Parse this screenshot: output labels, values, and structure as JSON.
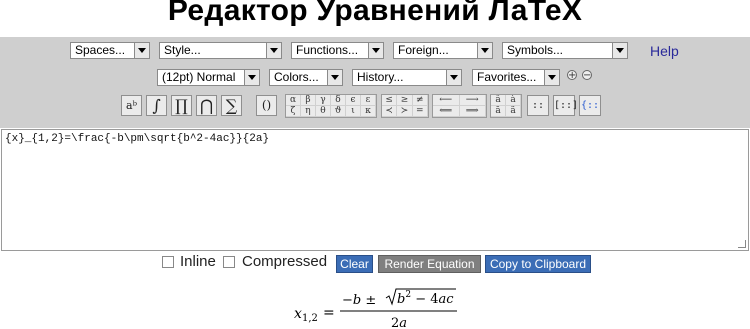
{
  "header": {
    "title": "Редактор Уравнений ЛаТеХ"
  },
  "toolbar": {
    "row1": [
      "Spaces...",
      "Style...",
      "Functions...",
      "Foreign...",
      "Symbols..."
    ],
    "help": "Help",
    "row2": [
      "(12pt) Normal",
      "Colors...",
      "History...",
      "Favorites..."
    ],
    "zoom_in": "+",
    "zoom_out": "−",
    "buttons": [
      "aᵇ",
      "∫",
      "∏",
      "⋂",
      "∑",
      "()"
    ],
    "greek": [
      "α",
      "β",
      "γ",
      "δ",
      "ϵ",
      "ε",
      "ζ",
      "η",
      "θ",
      "ϑ",
      "ι",
      "κ"
    ],
    "relations": [
      "≤",
      "≥",
      "≠",
      "≺",
      "≻",
      "="
    ],
    "arrows": [
      "⟵",
      "⟶",
      "⟸",
      "⟹"
    ],
    "accents": [
      "â",
      "à",
      "ā",
      "ä"
    ],
    "matrices": [
      "::",
      "[::]",
      "{::"
    ]
  },
  "editor": {
    "value": "{x}_{1,2}=\\frac{-b\\pm\\sqrt{b^2-4ac}}{2a}"
  },
  "options": {
    "inline": "Inline",
    "compressed": "Compressed"
  },
  "actions": {
    "clear": "Clear",
    "render": "Render Equation",
    "copy": "Copy to Clipboard"
  },
  "colors": {
    "clear": "#3b6db6",
    "render": "#7f7f7f",
    "copy": "#3b6db6"
  }
}
